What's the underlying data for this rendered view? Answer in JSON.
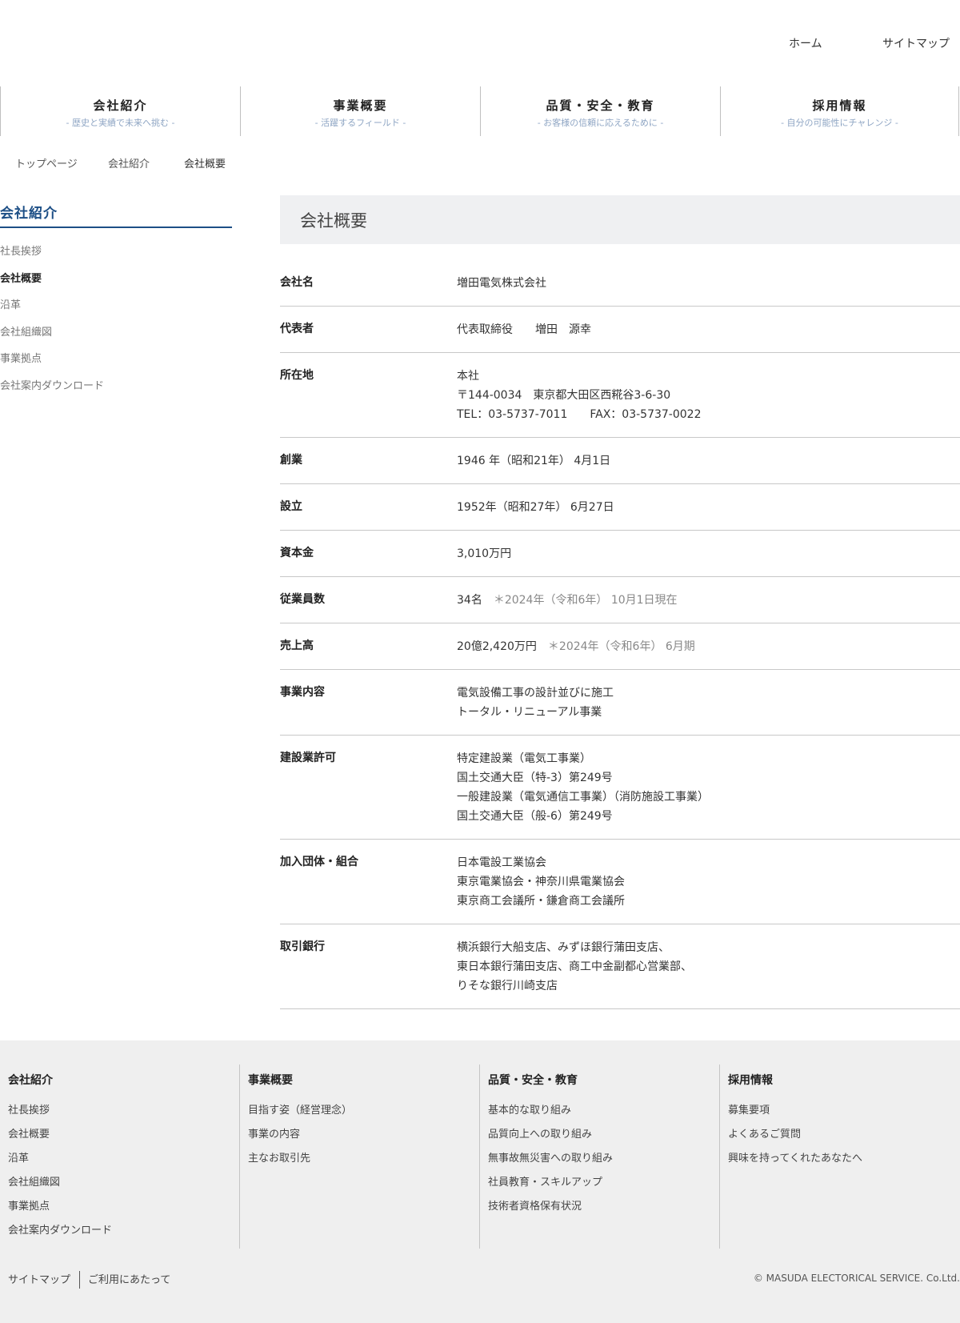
{
  "header": {
    "top_links": {
      "home": "ホーム",
      "sitemap": "サイトマップ"
    }
  },
  "global_nav": [
    {
      "label": "会社紹介",
      "sub": "- 歴史と実績で未来へ挑む -"
    },
    {
      "label": "事業概要",
      "sub": "- 活躍するフィールド -"
    },
    {
      "label": "品質・安全・教育",
      "sub": "- お客様の信頼に応えるために -"
    },
    {
      "label": "採用情報",
      "sub": "- 自分の可能性にチャレンジ -"
    }
  ],
  "breadcrumb": [
    "トップページ",
    "会社紹介",
    "会社概要"
  ],
  "sidebar": {
    "title": "会社紹介",
    "items": [
      "社長挨拶",
      "会社概要",
      "沿革",
      "会社組織図",
      "事業拠点",
      "会社案内ダウンロード"
    ]
  },
  "main": {
    "heading": "会社概要",
    "rows": [
      {
        "label": "会社名",
        "lines": [
          "増田電気株式会社"
        ]
      },
      {
        "label": "代表者",
        "lines": [
          "代表取締役　　増田　源幸"
        ]
      },
      {
        "label": "所在地",
        "lines": [
          "本社",
          "〒144-0034　東京都大田区西糀谷3-6-30",
          "TEL：03-5737-7011　　FAX：03-5737-0022"
        ]
      },
      {
        "label": "創業",
        "lines": [
          "1946 年（昭和21年） 4月1日"
        ]
      },
      {
        "label": "設立",
        "lines": [
          "1952年（昭和27年） 6月27日"
        ]
      },
      {
        "label": "資本金",
        "lines": [
          "3,010万円"
        ]
      },
      {
        "label": "従業員数",
        "lines": [
          "34名"
        ],
        "note": "＊2024年（令和6年） 10月1日現在"
      },
      {
        "label": "売上高",
        "lines": [
          "20億2,420万円"
        ],
        "note": "＊2024年（令和6年） 6月期"
      },
      {
        "label": "事業内容",
        "lines": [
          "電気設備工事の設計並びに施工",
          "トータル・リニューアル事業"
        ]
      },
      {
        "label": "建設業許可",
        "lines": [
          "特定建設業（電気工事業）",
          "国土交通大臣（特-3）第249号",
          "一般建設業（電気通信工事業）（消防施設工事業）",
          "国土交通大臣（般-6）第249号"
        ]
      },
      {
        "label": "加入団体・組合",
        "lines": [
          "日本電設工業協会",
          "東京電業協会・神奈川県電業協会",
          "東京商工会議所・鎌倉商工会議所"
        ]
      },
      {
        "label": "取引銀行",
        "lines": [
          "横浜銀行大船支店、みずほ銀行蒲田支店、",
          "東日本銀行蒲田支店、商工中金副都心営業部、",
          "りそな銀行川崎支店"
        ]
      }
    ]
  },
  "footer": {
    "columns": [
      {
        "title": "会社紹介",
        "links": [
          "社長挨拶",
          "会社概要",
          "沿革",
          "会社組織図",
          "事業拠点",
          "会社案内ダウンロード"
        ]
      },
      {
        "title": "事業概要",
        "links": [
          "目指す姿（経営理念）",
          "事業の内容",
          "主なお取引先"
        ]
      },
      {
        "title": "品質・安全・教育",
        "links": [
          "基本的な取り組み",
          "品質向上への取り組み",
          "無事故無災害への取り組み",
          "社員教育・スキルアップ",
          "技術者資格保有状況"
        ]
      },
      {
        "title": "採用情報",
        "links": [
          "募集要項",
          "よくあるご質問",
          "興味を持ってくれたあなたへ"
        ]
      }
    ],
    "bottom": {
      "sitemap": "サイトマップ",
      "terms": "ご利用にあたって",
      "copyright": "© MASUDA ELECTORICAL SERVICE. Co.Ltd."
    }
  },
  "colors": {
    "accent": "#1d4f86",
    "nav_sub": "#8fa6c4",
    "heading_bg": "#eff0f2",
    "footer_bg": "#efefef"
  }
}
